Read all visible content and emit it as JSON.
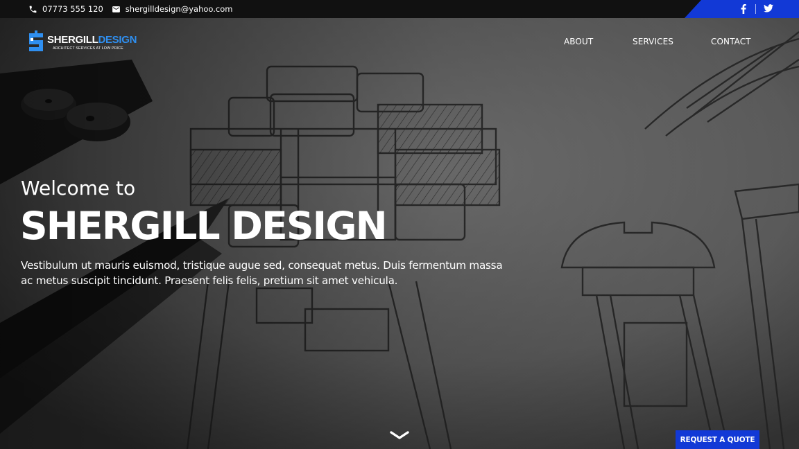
{
  "topbar": {
    "phone": "07773 555 120",
    "email": "shergilldesign@yahoo.com",
    "phone_icon": "phone-icon",
    "email_icon": "envelope-icon",
    "social": [
      "facebook-icon",
      "twitter-icon"
    ]
  },
  "brand": {
    "name_main": "SHERGILL",
    "name_accent": "DESIGN",
    "tagline": "ARCHITECT SERVICES AT LOW PRICE"
  },
  "nav": {
    "items": [
      {
        "label": "ABOUT"
      },
      {
        "label": "SERVICES"
      },
      {
        "label": "CONTACT"
      }
    ]
  },
  "hero": {
    "welcome": "Welcome to",
    "headline": "SHERGILL DESIGN",
    "description": "Vestibulum ut mauris euismod, tristique augue sed, consequat metus. Duis fermentum massa ac metus suscipit tincidunt. Praesent felis felis, pretium sit amet vehicula.",
    "scroll_icon": "chevron-down-icon",
    "cta_label": "REQUEST A QUOTE"
  },
  "colors": {
    "accent": "#1239d6",
    "logo_blue": "#2f8ff0",
    "topbar_bg": "#111111"
  }
}
